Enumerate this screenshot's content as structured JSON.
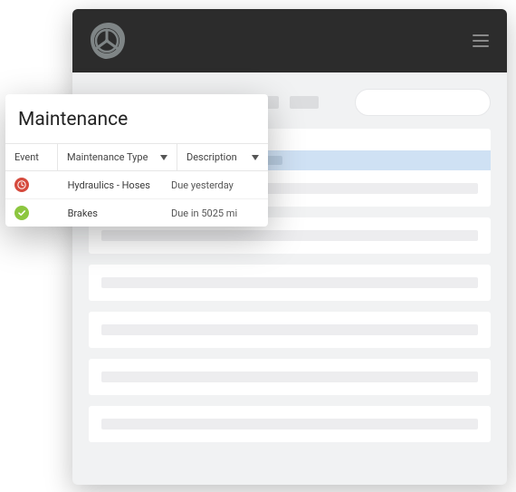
{
  "panel": {
    "title": "Maintenance",
    "columns": {
      "event": "Event",
      "type": "Maintenance Type",
      "description": "Description"
    },
    "rows": [
      {
        "status": "overdue",
        "type": "Hydraulics - Hoses",
        "description": "Due yesterday"
      },
      {
        "status": "ok",
        "type": "Brakes",
        "description": "Due in 5025 mi"
      }
    ]
  },
  "icons": {
    "logo": "steering-wheel",
    "menu": "hamburger",
    "overdue": "clock",
    "ok": "check"
  }
}
